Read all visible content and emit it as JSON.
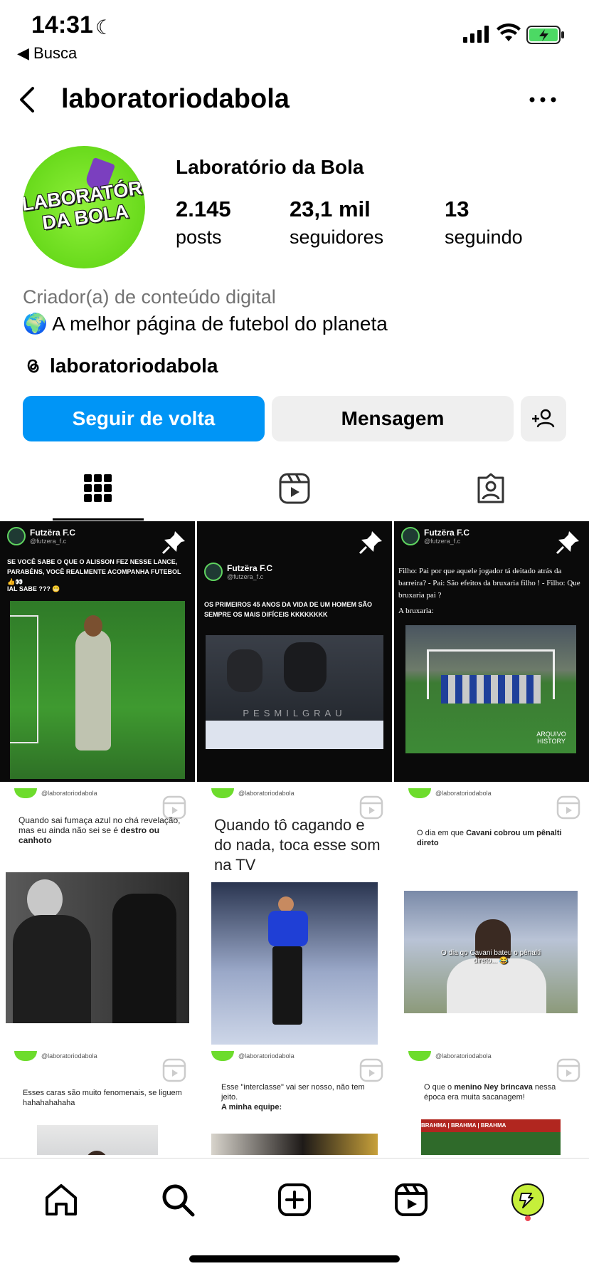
{
  "status_bar": {
    "time": "14:31",
    "back_app": "◀ Busca"
  },
  "header": {
    "username": "laboratoriodabola"
  },
  "profile": {
    "avatar_text": "LABORATÓRIO DA BOLA",
    "display_name": "Laboratório da Bola",
    "stats": [
      {
        "value": "2.145",
        "label": "posts"
      },
      {
        "value": "23,1 mil",
        "label": "seguidores"
      },
      {
        "value": "13",
        "label": "seguindo"
      }
    ],
    "category": "Criador(a) de conteúdo digital",
    "bio": "🌍 A melhor página de futebol do planeta",
    "threads_handle": "laboratoriodabola"
  },
  "actions": {
    "follow_back": "Seguir de volta",
    "message": "Mensagem"
  },
  "posts": {
    "p1": {
      "source": "Futzëra F.C",
      "handle": "@futzera_f.c",
      "text": "SE VOCÊ SABE O QUE O ALISSON FEZ NESSE LANCE, PARABÉNS, VOCÊ REALMENTE ACOMPANHA FUTEBOL 👍👀",
      "text2": "IAL SABE ??? 😬"
    },
    "p2": {
      "source": "Futzëra F.C",
      "handle": "@futzera_f.c",
      "text": "OS PRIMEIROS 45 ANOS DA VIDA DE UM HOMEM SÃO SEMPRE OS MAIS DIFÍCEIS KKKKKKKK",
      "watermark": "PESMILGRAU"
    },
    "p3": {
      "source": "Futzëra F.C",
      "handle": "@futzera_f.c",
      "text": "Filho: Pai por que aquele jogador tá deitado atrás da barreira? - Pai: São efeitos da bruxaria filho ! - Filho: Que bruxaria pai ?",
      "text2": "A bruxaria:",
      "watermark": "ARQUIVO HISTORY"
    },
    "p4": {
      "account": "@laboratoriodabola",
      "text_a": "Quando sai fumaça azul no chá revelação, mas eu ainda não sei se é ",
      "text_b": "destro ou canhoto"
    },
    "p5": {
      "account": "@laboratoriodabola",
      "text": "Quando tô cagando e do nada, toca esse som na TV"
    },
    "p6": {
      "account": "@laboratoriodabola",
      "text_a": "O dia em que ",
      "text_b": "Cavani cobrou um pênalti direto",
      "caption": "O dia qo Cavani bateu o pênalti direto... 😂"
    },
    "p7": {
      "account": "@laboratoriodabola",
      "text": "Esses caras são muito fenomenais, se liguem hahahahahaha"
    },
    "p8": {
      "account": "@laboratoriodabola",
      "text_a": "Esse \"interclasse\" vai ser nosso, não tem jeito.",
      "text_b": "A minha equipe:"
    },
    "p9": {
      "account": "@laboratoriodabola",
      "text_a": "O que o ",
      "text_b": "menino Ney brincava",
      "text_c": " nessa época era muita sacanagem!",
      "banner": "BRAHMA | BRAHMA | BRAHMA"
    }
  },
  "colors": {
    "follow_button": "#0095f6",
    "secondary_button": "#efefef",
    "avatar_green": "#6ddc2c",
    "notification_dot": "#ed4956"
  },
  "icons": [
    "back-chevron-icon",
    "more-icon",
    "threads-icon",
    "add-person-icon",
    "grid-icon",
    "reels-icon",
    "tagged-icon",
    "pin-icon",
    "reel-badge-icon",
    "home-icon",
    "search-icon",
    "create-icon",
    "reels-nav-icon",
    "profile-avatar-icon"
  ]
}
